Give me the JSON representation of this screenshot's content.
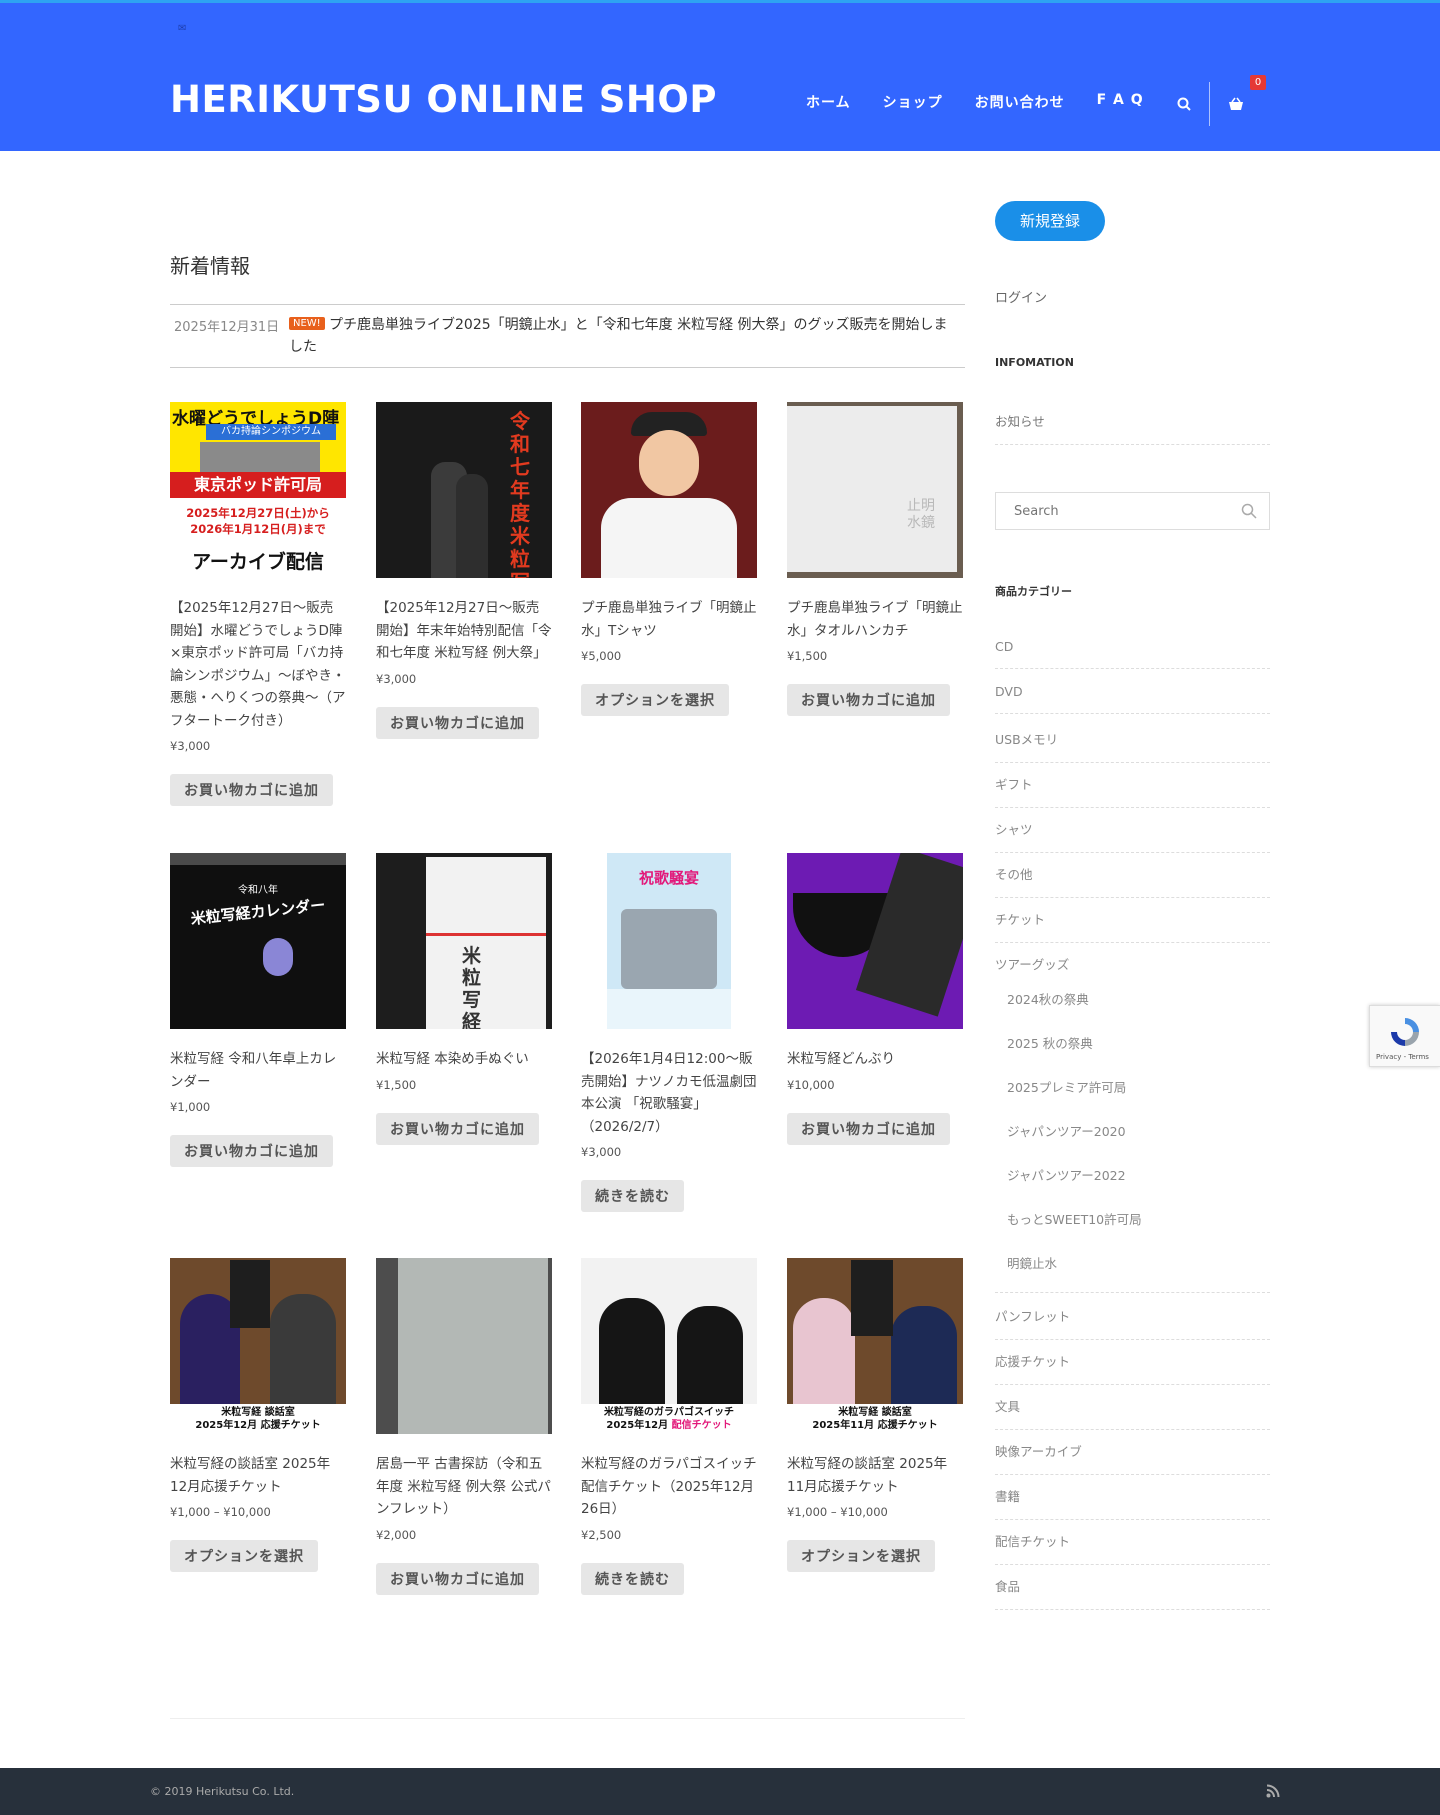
{
  "header": {
    "logo": "HERIKUTSU ONLINE SHOP",
    "nav": [
      "ホーム",
      "ショップ",
      "お問い合わせ",
      "F A Q"
    ],
    "cart_count": "0"
  },
  "news": {
    "title": "新着情報",
    "date": "2025年12月31日",
    "badge": "NEW!",
    "text": "プチ鹿島単独ライブ2025「明鏡止水」と「令和七年度 米粒写経 例大祭」のグッズ販売を開始しました"
  },
  "products": [
    {
      "name": "【2025年12月27日～販売開始】水曜どうでしょうD陣×東京ポッド許可局「バカ持論シンポジウム」～ぼやき・悪態・へりくつの祭典～（アフタートーク付き）",
      "price": "¥3,000",
      "button": "お買い物カゴに追加",
      "thumb": {
        "title": "水曜どうでしょうD陣",
        "sub": "バカ持論シンポジウム",
        "mid": "東京ポッド許可局",
        "dates": "2025年12月27日(土)から\n2026年1月12日(月)まで",
        "foot": "アーカイブ配信"
      }
    },
    {
      "name": "【2025年12月27日～販売開始】年末年始特別配信「令和七年度 米粒写経 例大祭」",
      "price": "¥3,000",
      "button": "お買い物カゴに追加",
      "thumb": {
        "title": "令和七年度 米粒写経 例大祭"
      }
    },
    {
      "name": "プチ鹿島単独ライブ「明鏡止水」Tシャツ",
      "price": "¥5,000",
      "button": "オプションを選択"
    },
    {
      "name": "プチ鹿島単独ライブ「明鏡止水」タオルハンカチ",
      "price": "¥1,500",
      "button": "お買い物カゴに追加",
      "thumb": {
        "title": "止明水鏡"
      }
    },
    {
      "name": "米粒写経 令和八年卓上カレンダー",
      "price": "¥1,000",
      "button": "お買い物カゴに追加",
      "thumb": {
        "title": "米粒写経カレンダー",
        "sub": "令和八年"
      }
    },
    {
      "name": "米粒写経 本染め手ぬぐい",
      "price": "¥1,500",
      "button": "お買い物カゴに追加",
      "thumb": {
        "title": "米粒写経"
      }
    },
    {
      "name": "【2026年1月4日12:00～販売開始】ナツノカモ低温劇団 本公演 「祝歌騒宴」（2026/2/7）",
      "price": "¥3,000",
      "button": "続きを読む",
      "thumb": {
        "title": "祝歌騒宴"
      }
    },
    {
      "name": "米粒写経どんぶり",
      "price": "¥10,000",
      "button": "お買い物カゴに追加"
    },
    {
      "name": "米粒写経の談話室 2025年12月応援チケット",
      "price": "¥1,000 – ¥10,000",
      "button": "オプションを選択",
      "thumb": {
        "title": "米粒写経 談話室",
        "foot": "米粒写経 談話室\n2025年12月 応援チケット"
      }
    },
    {
      "name": "居島一平 古書探訪（令和五年度 米粒写経 例大祭 公式パンフレット）",
      "price": "¥2,000",
      "button": "お買い物カゴに追加"
    },
    {
      "name": "米粒写経のガラパゴスイッチ　配信チケット（2025年12月26日）",
      "price": "¥2,500",
      "button": "続きを読む",
      "thumb": {
        "foot": "米粒写経のガラパゴスイッチ",
        "foot2a": "2025年12月 ",
        "foot2b": "配信チケット"
      }
    },
    {
      "name": "米粒写経の談話室 2025年11月応援チケット",
      "price": "¥1,000 – ¥10,000",
      "button": "オプションを選択",
      "thumb": {
        "title": "米粒写経 談話室",
        "foot": "米粒写経 談話室\n2025年11月 応援チケット"
      }
    }
  ],
  "sidebar": {
    "signup": "新規登録",
    "login": "ログイン",
    "info_heading": "INFOMATION",
    "info_link": "お知らせ",
    "search_placeholder": "Search",
    "cat_heading": "商品カテゴリー",
    "categories_top": [
      "CD",
      "DVD",
      "USBメモリ",
      "ギフト",
      "シャツ",
      "その他",
      "チケット",
      "ツアーグッズ"
    ],
    "subcategories": [
      "2024秋の祭典",
      "2025 秋の祭典",
      "2025プレミア許可局",
      "ジャパンツアー2020",
      "ジャパンツアー2022",
      "もっとSWEET10許可局",
      "明鏡止水"
    ],
    "categories_bottom": [
      "パンフレット",
      "応援チケット",
      "文具",
      "映像アーカイブ",
      "書籍",
      "配信チケット",
      "食品"
    ]
  },
  "recaptcha": {
    "text": "Privacy - Terms"
  },
  "footer": {
    "copyright": "© 2019 Herikutsu Co. Ltd."
  },
  "colors": {
    "header": "#3366ff",
    "accent": "#1a8fe8",
    "footer": "#27303b",
    "badge": "#e8601c"
  }
}
